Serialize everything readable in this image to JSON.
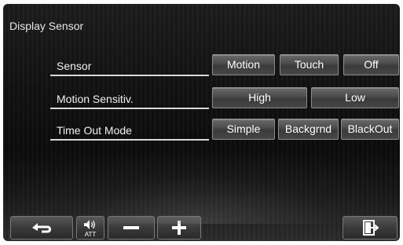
{
  "header": {
    "title": "Display Sensor"
  },
  "rows": [
    {
      "label": "Sensor",
      "options": [
        "Motion",
        "Touch",
        "Off"
      ]
    },
    {
      "label": "Motion Sensitiv.",
      "options": [
        "High",
        "Low"
      ]
    },
    {
      "label": "Time Out Mode",
      "options": [
        "Simple",
        "Backgrnd",
        "BlackOut"
      ]
    }
  ],
  "bottom_bar": {
    "back_icon": "back-arrow-icon",
    "volume_icon": "speaker-icon",
    "att_label": "ATT",
    "minus_icon": "minus-icon",
    "plus_icon": "plus-icon",
    "exit_icon": "exit-icon"
  }
}
